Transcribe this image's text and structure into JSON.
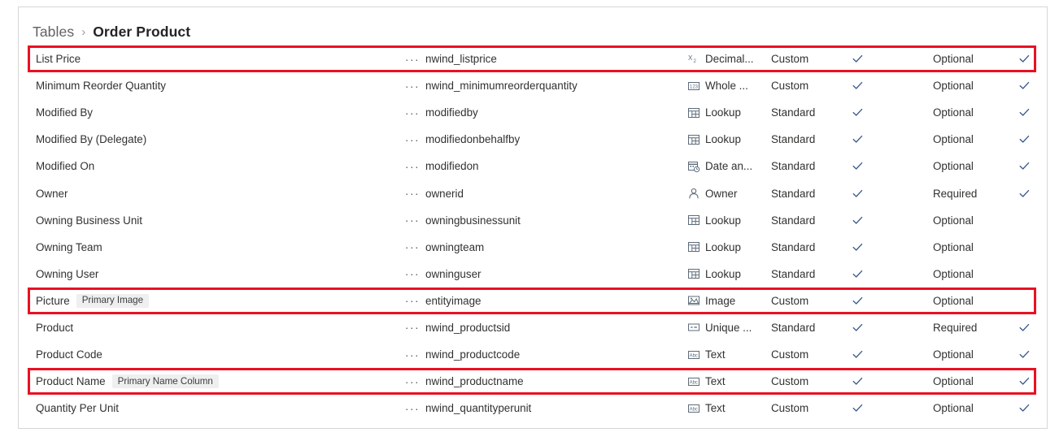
{
  "breadcrumb": {
    "parent": "Tables",
    "separator": "›",
    "current": "Order Product"
  },
  "colors": {
    "highlight": "#e81123",
    "text": "#323130",
    "muted": "#616161",
    "badge_bg": "#efefef",
    "check": "#3a5a8c",
    "panel_border": "#d6d6d6"
  },
  "icons": {
    "ellipsis": "ellipsis-icon",
    "check": "check-icon",
    "decimal": "decimal-number-icon",
    "whole": "whole-number-icon",
    "lookup": "lookup-icon",
    "datetime": "date-time-icon",
    "owner": "owner-person-icon",
    "image": "image-icon",
    "unique": "unique-identifier-icon",
    "text": "text-abc-icon"
  },
  "grid": {
    "rows": [
      {
        "display_name": "List Price",
        "badge": "",
        "logical_name": "nwind_listprice",
        "data_type": "Decimal...",
        "type_icon": "decimal",
        "customization": "Custom",
        "check1": true,
        "requirement": "Optional",
        "check2": true,
        "highlighted": true
      },
      {
        "display_name": "Minimum Reorder Quantity",
        "badge": "",
        "logical_name": "nwind_minimumreorderquantity",
        "data_type": "Whole ...",
        "type_icon": "whole",
        "customization": "Custom",
        "check1": true,
        "requirement": "Optional",
        "check2": true,
        "highlighted": false
      },
      {
        "display_name": "Modified By",
        "badge": "",
        "logical_name": "modifiedby",
        "data_type": "Lookup",
        "type_icon": "lookup",
        "customization": "Standard",
        "check1": true,
        "requirement": "Optional",
        "check2": true,
        "highlighted": false
      },
      {
        "display_name": "Modified By (Delegate)",
        "badge": "",
        "logical_name": "modifiedonbehalfby",
        "data_type": "Lookup",
        "type_icon": "lookup",
        "customization": "Standard",
        "check1": true,
        "requirement": "Optional",
        "check2": true,
        "highlighted": false
      },
      {
        "display_name": "Modified On",
        "badge": "",
        "logical_name": "modifiedon",
        "data_type": "Date an...",
        "type_icon": "datetime",
        "customization": "Standard",
        "check1": true,
        "requirement": "Optional",
        "check2": true,
        "highlighted": false
      },
      {
        "display_name": "Owner",
        "badge": "",
        "logical_name": "ownerid",
        "data_type": "Owner",
        "type_icon": "owner",
        "customization": "Standard",
        "check1": true,
        "requirement": "Required",
        "check2": true,
        "highlighted": false
      },
      {
        "display_name": "Owning Business Unit",
        "badge": "",
        "logical_name": "owningbusinessunit",
        "data_type": "Lookup",
        "type_icon": "lookup",
        "customization": "Standard",
        "check1": true,
        "requirement": "Optional",
        "check2": false,
        "highlighted": false
      },
      {
        "display_name": "Owning Team",
        "badge": "",
        "logical_name": "owningteam",
        "data_type": "Lookup",
        "type_icon": "lookup",
        "customization": "Standard",
        "check1": true,
        "requirement": "Optional",
        "check2": false,
        "highlighted": false
      },
      {
        "display_name": "Owning User",
        "badge": "",
        "logical_name": "owninguser",
        "data_type": "Lookup",
        "type_icon": "lookup",
        "customization": "Standard",
        "check1": true,
        "requirement": "Optional",
        "check2": false,
        "highlighted": false
      },
      {
        "display_name": "Picture",
        "badge": "Primary Image",
        "logical_name": "entityimage",
        "data_type": "Image",
        "type_icon": "image",
        "customization": "Custom",
        "check1": true,
        "requirement": "Optional",
        "check2": false,
        "highlighted": true
      },
      {
        "display_name": "Product",
        "badge": "",
        "logical_name": "nwind_productsid",
        "data_type": "Unique ...",
        "type_icon": "unique",
        "customization": "Standard",
        "check1": true,
        "requirement": "Required",
        "check2": true,
        "highlighted": false
      },
      {
        "display_name": "Product Code",
        "badge": "",
        "logical_name": "nwind_productcode",
        "data_type": "Text",
        "type_icon": "text",
        "customization": "Custom",
        "check1": true,
        "requirement": "Optional",
        "check2": true,
        "highlighted": false
      },
      {
        "display_name": "Product Name",
        "badge": "Primary Name Column",
        "logical_name": "nwind_productname",
        "data_type": "Text",
        "type_icon": "text",
        "customization": "Custom",
        "check1": true,
        "requirement": "Optional",
        "check2": true,
        "highlighted": true
      },
      {
        "display_name": "Quantity Per Unit",
        "badge": "",
        "logical_name": "nwind_quantityperunit",
        "data_type": "Text",
        "type_icon": "text",
        "customization": "Custom",
        "check1": true,
        "requirement": "Optional",
        "check2": true,
        "highlighted": false
      }
    ]
  }
}
